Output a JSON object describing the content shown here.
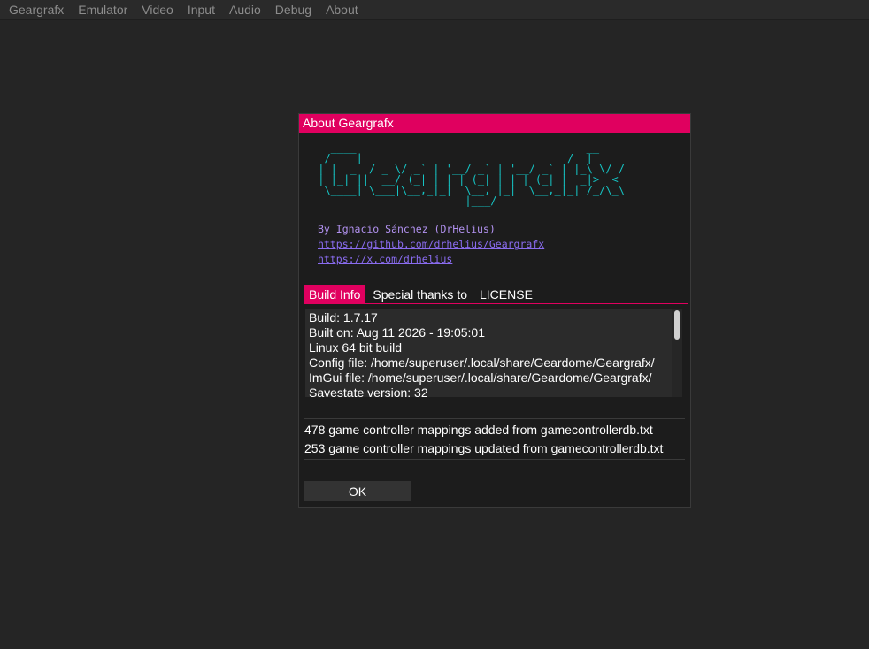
{
  "menubar": {
    "items": [
      "Geargrafx",
      "Emulator",
      "Video",
      "Input",
      "Audio",
      "Debug",
      "About"
    ]
  },
  "dialog": {
    "title": "About Geargrafx",
    "ascii_logo": "   ____                                    __\n  / ___|  ___  __ _ _ __ __ _ _ __ __ _ / _|_  __\n | |  _  / _ \\/ _` | '__/ _` | '__/ _` | |_\\ \\/ /\n | |_| ||  __/ (_| | | | (_| | | | (_| |  _|>  <\n  \\____| \\___|\\__,_|_|  \\__, |_|  \\__,_|_| /_/\\_\\\n                        |___/",
    "author": "By Ignacio Sánchez (DrHelius)",
    "links": [
      "https://github.com/drhelius/Geargrafx",
      "https://x.com/drhelius"
    ],
    "tabs": [
      {
        "label": "Build Info",
        "active": true
      },
      {
        "label": "Special thanks to",
        "active": false
      },
      {
        "label": "LICENSE",
        "active": false
      }
    ],
    "build_info": [
      "Build: 1.7.17",
      "Built on: Aug 11 2026 - 19:05:01",
      "Linux 64 bit build",
      "Config file: /home/superuser/.local/share/Geardome/Geargrafx/",
      "ImGui file: /home/superuser/.local/share/Geardome/Geargrafx/",
      "Savestate version: 32"
    ],
    "log_lines": [
      "478 game controller mappings added from gamecontrollerdb.txt",
      "253 game controller mappings updated from gamecontrollerdb.txt"
    ],
    "ok_label": "OK"
  },
  "colors": {
    "accent": "#e0005f",
    "logo": "#16c4c4",
    "author": "#b292f0",
    "link": "#8a6cf0",
    "background": "#252525"
  }
}
